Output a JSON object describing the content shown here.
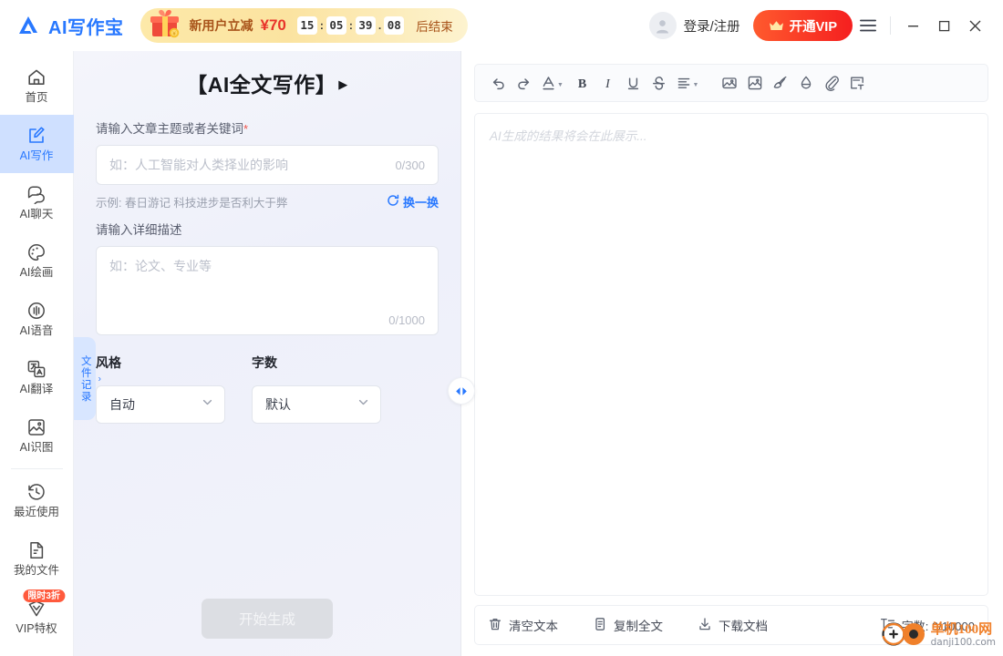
{
  "app": {
    "logo_text": "AI写作宝",
    "logo_icon": "triangle-logo-icon"
  },
  "promo": {
    "gift_icon": "gift-box-icon",
    "text": "新用户立减",
    "amount": "¥70",
    "hours": "15",
    "minutes": "05",
    "seconds": "39",
    "centis": "08",
    "sep_colon": ":",
    "sep_dot": ".",
    "end_label": "后结束",
    "accent": "#e8332a",
    "bg_start": "#fde9a9",
    "bg_end": "#fdf3cf"
  },
  "titlebar": {
    "account_label": "登录/注册",
    "account_icon": "user-avatar-icon",
    "vip_label": "开通VIP",
    "vip_icon": "crown-icon",
    "menu_icon": "hamburger-menu-icon",
    "minimize_icon": "minimize-icon",
    "maximize_icon": "maximize-icon",
    "close_icon": "close-icon",
    "vip_color": "#f51f1f"
  },
  "sidebar": {
    "items": [
      {
        "label": "首页",
        "icon": "home-icon",
        "active": false
      },
      {
        "label": "AI写作",
        "icon": "edit-square-icon",
        "active": true
      },
      {
        "label": "AI聊天",
        "icon": "chat-bubble-icon",
        "active": false
      },
      {
        "label": "AI绘画",
        "icon": "palette-icon",
        "active": false
      },
      {
        "label": "AI语音",
        "icon": "waveform-icon",
        "active": false
      },
      {
        "label": "AI翻译",
        "icon": "translate-icon",
        "active": false
      },
      {
        "label": "AI识图",
        "icon": "image-scan-icon",
        "active": false
      },
      {
        "label": "最近使用",
        "icon": "history-icon",
        "active": false
      },
      {
        "label": "我的文件",
        "icon": "document-icon",
        "active": false
      },
      {
        "label": "VIP特权",
        "icon": "vip-shield-icon",
        "active": false,
        "badge": "限时3折"
      }
    ],
    "active_color": "#2878ff",
    "active_bg": "#cfe0ff",
    "badge_color": "#ff5a3d"
  },
  "file_tab": {
    "label": "文件记录",
    "caret_icon": "chevron-right-icon"
  },
  "form": {
    "title": "【AI全文写作】",
    "title_caret_icon": "play-triangle-icon",
    "topic_label": "请输入文章主题或者关键词",
    "topic_required": "*",
    "topic_placeholder": "如：人工智能对人类择业的影响",
    "topic_counter": "0/300",
    "example_hint": "示例: 春日游记 科技进步是否利大于弊",
    "refresh_label": "换一换",
    "refresh_icon": "refresh-icon",
    "detail_label": "请输入详细描述",
    "detail_placeholder": "如：论文、专业等",
    "detail_counter": "0/1000",
    "style_title": "风格",
    "style_value": "自动",
    "words_title": "字数",
    "words_value": "默认",
    "dropdown_icon": "chevron-down-icon",
    "generate_label": "开始生成"
  },
  "splitter": {
    "handle_icon": "collapse-expand-handle-icon"
  },
  "editor": {
    "toolbar": [
      {
        "name": "undo-icon",
        "label": "撤销"
      },
      {
        "name": "redo-icon",
        "label": "重做"
      },
      {
        "name": "font-color-icon",
        "label": "字体颜色"
      },
      {
        "name": "bold-icon",
        "label": "加粗"
      },
      {
        "name": "italic-icon",
        "label": "斜体"
      },
      {
        "name": "underline-icon",
        "label": "下划线"
      },
      {
        "name": "strikethrough-icon",
        "label": "删除线"
      },
      {
        "name": "align-icon",
        "label": "对齐"
      },
      {
        "name": "insert-image-icon",
        "label": "插入图片"
      },
      {
        "name": "image-frame-icon",
        "label": "图片编辑"
      },
      {
        "name": "brush-icon",
        "label": "画笔"
      },
      {
        "name": "eraser-drop-icon",
        "label": "擦除"
      },
      {
        "name": "attachment-icon",
        "label": "附件"
      },
      {
        "name": "insert-text-icon",
        "label": "插入文本"
      }
    ],
    "placeholder": "AI生成的结果将会在此展示...",
    "footer": {
      "clear_label": "清空文本",
      "clear_icon": "trash-icon",
      "copy_label": "复制全文",
      "copy_icon": "copy-icon",
      "download_label": "下载文档",
      "download_icon": "download-icon",
      "wordcount_icon": "text-count-icon",
      "wordcount_label": "字数: 0/10000"
    }
  },
  "watermark": {
    "icon": "circle-logo-icon",
    "main": "单机100网",
    "sub": "danji100.com"
  }
}
